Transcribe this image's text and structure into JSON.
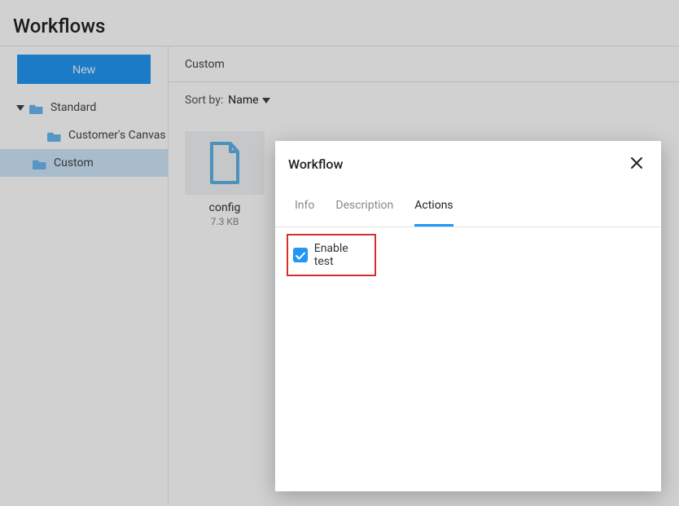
{
  "colors": {
    "accent": "#2196f3",
    "highlight": "#d32f2f"
  },
  "page": {
    "title": "Workflows"
  },
  "sidebar": {
    "new_button_label": "New",
    "items": [
      {
        "label": "Standard",
        "expanded": true
      },
      {
        "label": "Customer's Canvas"
      },
      {
        "label": "Custom",
        "selected": true
      }
    ]
  },
  "main": {
    "breadcrumb": "Custom",
    "sort_prefix": "Sort by:",
    "sort_value": "Name",
    "files": [
      {
        "name": "config",
        "size": "7.3 KB"
      }
    ]
  },
  "panel": {
    "title": "Workflow",
    "tabs": [
      {
        "label": "Info",
        "active": false
      },
      {
        "label": "Description",
        "active": false
      },
      {
        "label": "Actions",
        "active": true
      }
    ],
    "actions": {
      "enable_test_label": "Enable test",
      "enable_test_checked": true
    }
  }
}
